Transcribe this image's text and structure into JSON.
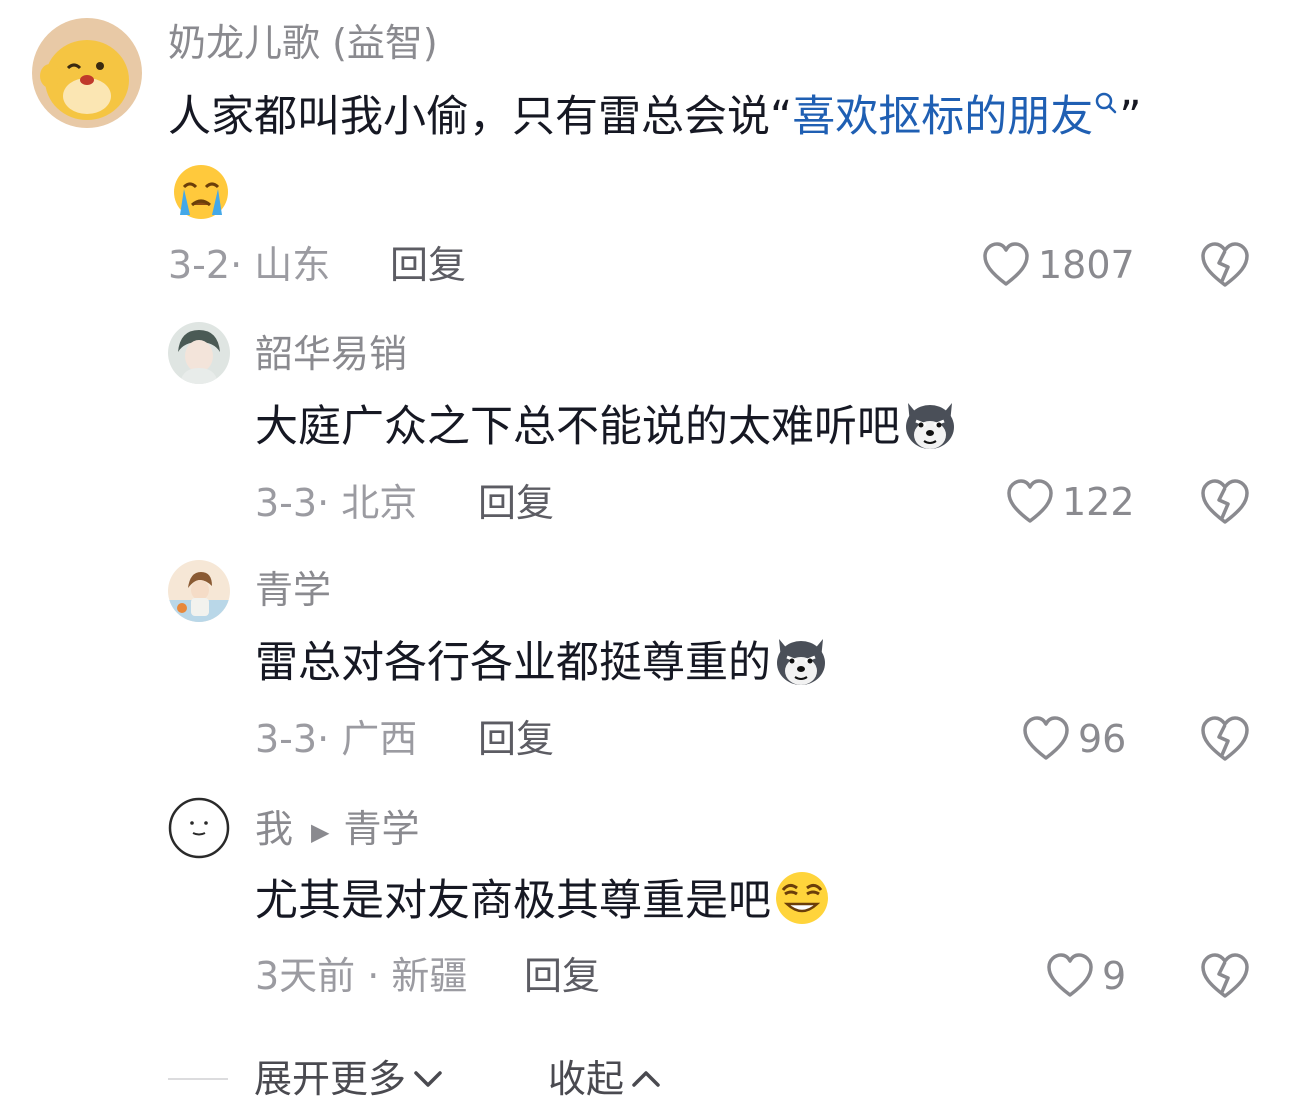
{
  "comments": [
    {
      "user": "奶龙儿歌 (益智)",
      "text_before": "人家都叫我小偷，只有雷总会说“",
      "link": "喜欢抠标的朋友",
      "text_after": "”",
      "emoji": "crying-emoji",
      "date": "3-2· 山东",
      "reply": "回复",
      "likes": "1807"
    },
    {
      "user": "韶华易销",
      "text": "大庭广众之下总不能说的太难听吧",
      "emoji": "husky-emoji",
      "date": "3-3· 北京",
      "reply": "回复",
      "likes": "122"
    },
    {
      "user": "青学",
      "text": "雷总对各行各业都挺尊重的",
      "emoji": "husky-emoji",
      "date": "3-3· 广西",
      "reply": "回复",
      "likes": "96"
    },
    {
      "user": "我",
      "reply_to": "青学",
      "text": "尤其是对友商极其尊重是吧",
      "emoji": "smirk-emoji",
      "date": "3天前 · 新疆",
      "reply": "回复",
      "likes": "9"
    }
  ],
  "footer": {
    "expand": "展开更多",
    "collapse": "收起"
  }
}
